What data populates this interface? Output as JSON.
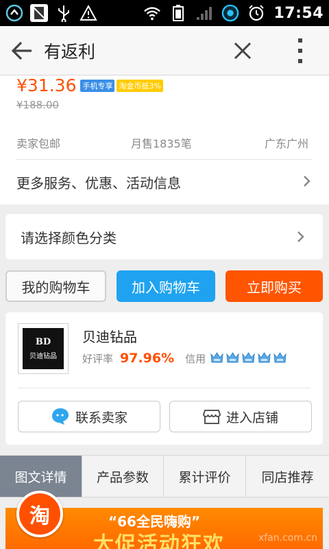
{
  "status_bar": {
    "time": "17:54",
    "icons": [
      "app-circle-icon",
      "no-sim-icon",
      "usb-icon",
      "warning-icon",
      "wifi-icon",
      "battery-full-icon",
      "signal-icon",
      "app-ring-icon",
      "alarm-icon"
    ]
  },
  "header": {
    "title": "有返利",
    "icons": [
      "back-arrow-icon",
      "close-icon",
      "more-vertical-icon"
    ]
  },
  "product": {
    "price": "¥31.36",
    "tag_mobile": "手机专享",
    "tag_coin": "淘金币抵3%",
    "original_price": "¥188.00",
    "shipping": "卖家包邮",
    "monthly_sales": "月售1835笔",
    "location": "广东广州",
    "more_info": "更多服务、优惠、活动信息"
  },
  "color_select": {
    "label": "请选择颜色分类"
  },
  "actions": {
    "my_cart": "我的购物车",
    "add_to_cart": "加入购物车",
    "buy_now": "立即购买"
  },
  "shop": {
    "logo_mark": "BD",
    "logo_text": "贝迪钻品",
    "name": "贝迪钻品",
    "rating_label": "好评率",
    "rating_value": "97.96%",
    "credit_label": "信用",
    "credit_crowns": 5,
    "contact_seller": "联系卖家",
    "enter_store": "进入店铺"
  },
  "tabs": [
    {
      "label": "图文详情",
      "active": true
    },
    {
      "label": "产品参数",
      "active": false
    },
    {
      "label": "累计评价",
      "active": false
    },
    {
      "label": "同店推荐",
      "active": false
    }
  ],
  "banner": {
    "line1": "“66全民嗨购”",
    "line2": "大促活动狂欢",
    "watermark": "xfan.com.cn"
  },
  "floating_badge": {
    "label": "淘"
  },
  "colors": {
    "accent_orange": "#ff5000",
    "accent_blue": "#1fa3f0",
    "buy_orange": "#ff5500",
    "tag_blue": "#3a8ee6",
    "tag_yellow": "#ffcc00",
    "tab_active": "#7b8491",
    "crown_blue": "#5aa9e6"
  }
}
